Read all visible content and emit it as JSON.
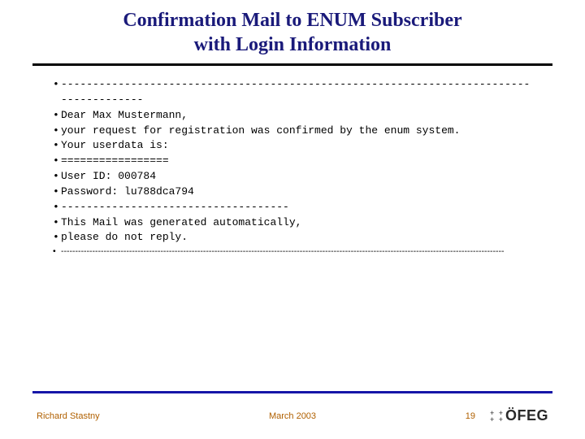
{
  "title": {
    "line1": "Confirmation Mail to ENUM Subscriber",
    "line2": "with Login Information"
  },
  "body": {
    "sep_top": "---------------------------------------------------------------------------------------",
    "greeting": "Dear Max Mustermann,",
    "confirm": "your request for registration was confirmed by the enum system.",
    "userdata_label": "Your userdata is:",
    "sep_eq": "=================",
    "user_id": "User ID: 000784",
    "password": "Password: lu788dca794",
    "sep_mid": "------------------------------------",
    "auto_line": "This Mail was generated automatically,",
    "noreply": "please do not reply.",
    "sep_bottom": "------------------------------------------------------------------------------------------------------------------------------------------------------------"
  },
  "footer": {
    "author": "Richard Stastny",
    "date": "March 2003",
    "page": "19",
    "logo_text": "ÖFEG"
  }
}
